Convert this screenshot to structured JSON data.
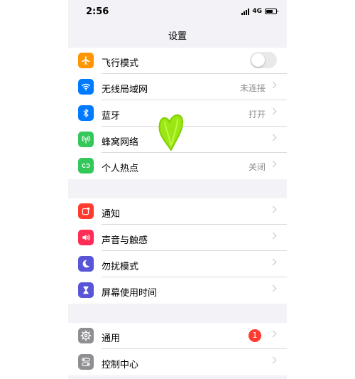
{
  "status_bar": {
    "time": "2:56",
    "network": "4G"
  },
  "nav": {
    "title": "设置"
  },
  "groups": [
    {
      "rows": [
        {
          "label": "飞行模式",
          "value": "",
          "icon": "airplane-icon",
          "color": "#ff9500",
          "toggle": false
        },
        {
          "label": "无线局域网",
          "value": "未连接",
          "icon": "wifi-icon",
          "color": "#007aff"
        },
        {
          "label": "蓝牙",
          "value": "打开",
          "icon": "bluetooth-icon",
          "color": "#007aff"
        },
        {
          "label": "蜂窝网络",
          "value": "",
          "icon": "antenna-icon",
          "color": "#34c759"
        },
        {
          "label": "个人热点",
          "value": "关闭",
          "icon": "hotspot-icon",
          "color": "#34c759"
        }
      ]
    },
    {
      "rows": [
        {
          "label": "通知",
          "value": "",
          "icon": "notification-icon",
          "color": "#ff3b30"
        },
        {
          "label": "声音与触感",
          "value": "",
          "icon": "speaker-icon",
          "color": "#ff2d55"
        },
        {
          "label": "勿扰模式",
          "value": "",
          "icon": "moon-icon",
          "color": "#5856d6"
        },
        {
          "label": "屏幕使用时间",
          "value": "",
          "icon": "hourglass-icon",
          "color": "#5856d6"
        }
      ]
    },
    {
      "rows": [
        {
          "label": "通用",
          "value": "",
          "icon": "gear-icon",
          "color": "#8e8e93",
          "badge": "1"
        },
        {
          "label": "控制中心",
          "value": "",
          "icon": "toggles-icon",
          "color": "#8e8e93"
        }
      ]
    }
  ],
  "annotation": {
    "icon": "green-heart-sticker",
    "color": "#9be615"
  }
}
